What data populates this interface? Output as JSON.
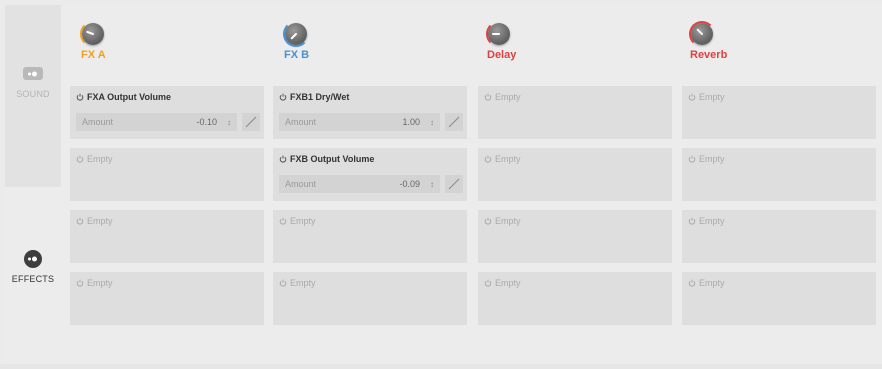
{
  "sidebar": {
    "tabs": [
      {
        "label": "SOUND",
        "active": false
      },
      {
        "label": "EFFECTS",
        "active": true
      }
    ]
  },
  "columns": [
    {
      "title": "FX A",
      "color": "#f0a020",
      "knob_level": 0.15
    },
    {
      "title": "FX B",
      "color": "#4a8fd0",
      "knob_level": 0.35
    },
    {
      "title": "Delay",
      "color": "#e04040",
      "knob_level": 0.2
    },
    {
      "title": "Reverb",
      "color": "#e04040",
      "knob_level": 0.05
    }
  ],
  "slots": [
    [
      {
        "name": "FXA Output Volume",
        "param": "Amount",
        "value": "-0.10",
        "filled": true
      },
      {
        "name": "Empty",
        "filled": false
      },
      {
        "name": "Empty",
        "filled": false
      },
      {
        "name": "Empty",
        "filled": false
      }
    ],
    [
      {
        "name": "FXB1 Dry/Wet",
        "param": "Amount",
        "value": "1.00",
        "filled": true
      },
      {
        "name": "FXB Output Volume",
        "param": "Amount",
        "value": "-0.09",
        "filled": true
      },
      {
        "name": "Empty",
        "filled": false
      },
      {
        "name": "Empty",
        "filled": false
      }
    ],
    [
      {
        "name": "Empty",
        "filled": false
      },
      {
        "name": "Empty",
        "filled": false
      },
      {
        "name": "Empty",
        "filled": false
      },
      {
        "name": "Empty",
        "filled": false
      }
    ],
    [
      {
        "name": "Empty",
        "filled": false
      },
      {
        "name": "Empty",
        "filled": false
      },
      {
        "name": "Empty",
        "filled": false
      },
      {
        "name": "Empty",
        "filled": false
      }
    ]
  ],
  "icons": {
    "power": "power-icon",
    "stepper": "↕",
    "modulation": "modulation-line-icon"
  }
}
